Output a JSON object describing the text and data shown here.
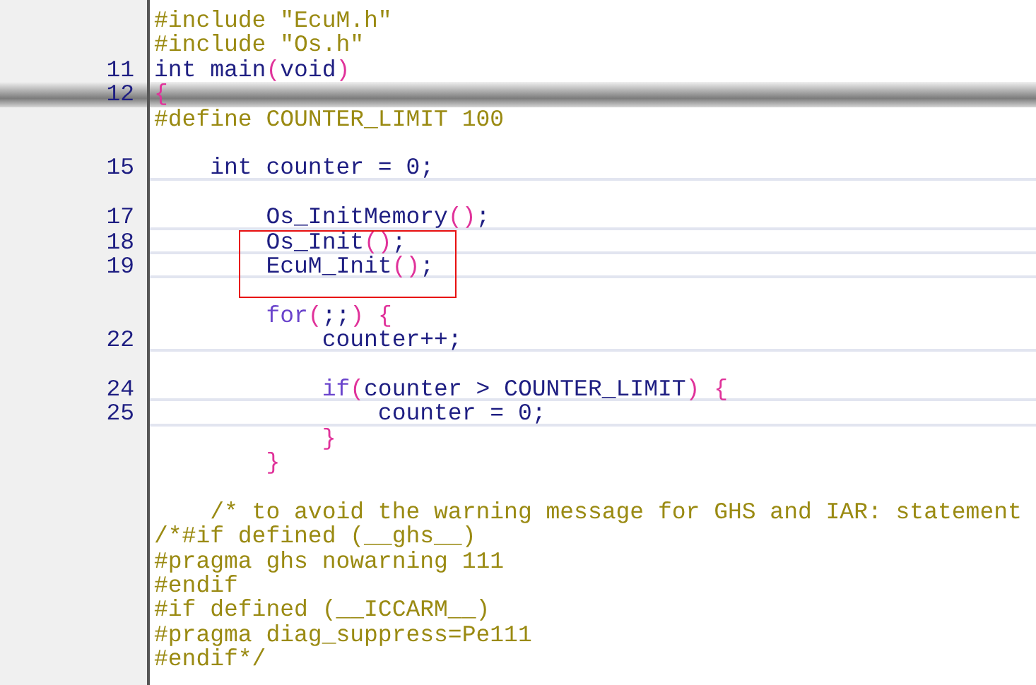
{
  "editor": {
    "lines": [
      {
        "current": false,
        "rule": false,
        "tokens": [
          {
            "kind": "preproc",
            "text": "#include \"EcuM.h\""
          }
        ]
      },
      {
        "current": false,
        "rule": false,
        "tokens": [
          {
            "kind": "preproc",
            "text": "#include \"Os.h\""
          }
        ]
      },
      {
        "number": "11",
        "current": false,
        "rule": false,
        "tokens": [
          {
            "kind": "plain",
            "text": "int main"
          },
          {
            "kind": "paren",
            "text": "("
          },
          {
            "kind": "plain",
            "text": "void"
          },
          {
            "kind": "paren",
            "text": ")"
          }
        ]
      },
      {
        "number": "12",
        "current": true,
        "rule": false,
        "tokens": [
          {
            "kind": "paren",
            "text": "{"
          }
        ]
      },
      {
        "current": false,
        "rule": false,
        "tokens": [
          {
            "kind": "preproc",
            "text": "#define COUNTER_LIMIT 100"
          }
        ]
      },
      {
        "current": false,
        "rule": false
      },
      {
        "number": "15",
        "current": false,
        "rule": true,
        "tokens": [
          {
            "kind": "plain",
            "text": "    int counter = 0;"
          }
        ]
      },
      {
        "current": false,
        "rule": false
      },
      {
        "number": "17",
        "current": false,
        "rule": true,
        "tokens": [
          {
            "kind": "plain",
            "text": "        Os_InitMemory"
          },
          {
            "kind": "paren",
            "text": "()"
          },
          {
            "kind": "plain",
            "text": ";"
          }
        ]
      },
      {
        "number": "18",
        "current": false,
        "rule": true,
        "tokens": [
          {
            "kind": "plain",
            "text": "        Os_Init"
          },
          {
            "kind": "paren",
            "text": "()"
          },
          {
            "kind": "plain",
            "text": ";"
          }
        ]
      },
      {
        "number": "19",
        "current": false,
        "rule": true,
        "tokens": [
          {
            "kind": "plain",
            "text": "        EcuM_Init"
          },
          {
            "kind": "paren",
            "text": "()"
          },
          {
            "kind": "plain",
            "text": ";"
          }
        ]
      },
      {
        "current": false,
        "rule": false
      },
      {
        "current": false,
        "rule": false,
        "tokens": [
          {
            "kind": "keyword",
            "text": "        for"
          },
          {
            "kind": "paren",
            "text": "("
          },
          {
            "kind": "plain",
            "text": ";;"
          },
          {
            "kind": "paren",
            "text": ") {"
          }
        ]
      },
      {
        "number": "22",
        "current": false,
        "rule": true,
        "tokens": [
          {
            "kind": "plain",
            "text": "            counter++;"
          }
        ]
      },
      {
        "current": false,
        "rule": false
      },
      {
        "number": "24",
        "current": false,
        "rule": true,
        "tokens": [
          {
            "kind": "keyword",
            "text": "            if"
          },
          {
            "kind": "paren",
            "text": "("
          },
          {
            "kind": "plain",
            "text": "counter > COUNTER_LIMIT"
          },
          {
            "kind": "paren",
            "text": ") {"
          }
        ]
      },
      {
        "number": "25",
        "current": false,
        "rule": true,
        "tokens": [
          {
            "kind": "plain",
            "text": "                counter = 0;"
          }
        ]
      },
      {
        "current": false,
        "rule": false,
        "tokens": [
          {
            "kind": "paren",
            "text": "            }"
          }
        ]
      },
      {
        "current": false,
        "rule": false,
        "tokens": [
          {
            "kind": "paren",
            "text": "        }"
          }
        ]
      },
      {
        "current": false,
        "rule": false
      },
      {
        "current": false,
        "rule": false,
        "tokens": [
          {
            "kind": "comment",
            "text": "    /* to avoid the warning message for GHS and IAR: statement"
          }
        ]
      },
      {
        "current": false,
        "rule": false,
        "tokens": [
          {
            "kind": "comment",
            "text": "/*#if defined (__ghs__)"
          }
        ]
      },
      {
        "current": false,
        "rule": false,
        "tokens": [
          {
            "kind": "comment",
            "text": "#pragma ghs nowarning 111"
          }
        ]
      },
      {
        "current": false,
        "rule": false,
        "tokens": [
          {
            "kind": "comment",
            "text": "#endif"
          }
        ]
      },
      {
        "current": false,
        "rule": false,
        "tokens": [
          {
            "kind": "comment",
            "text": "#if defined (__ICCARM__)"
          }
        ]
      },
      {
        "current": false,
        "rule": false,
        "tokens": [
          {
            "kind": "comment",
            "text": "#pragma diag_suppress=Pe111"
          }
        ]
      },
      {
        "current": false,
        "rule": false,
        "tokens": [
          {
            "kind": "comment",
            "text": "#endif*/"
          }
        ]
      }
    ]
  }
}
